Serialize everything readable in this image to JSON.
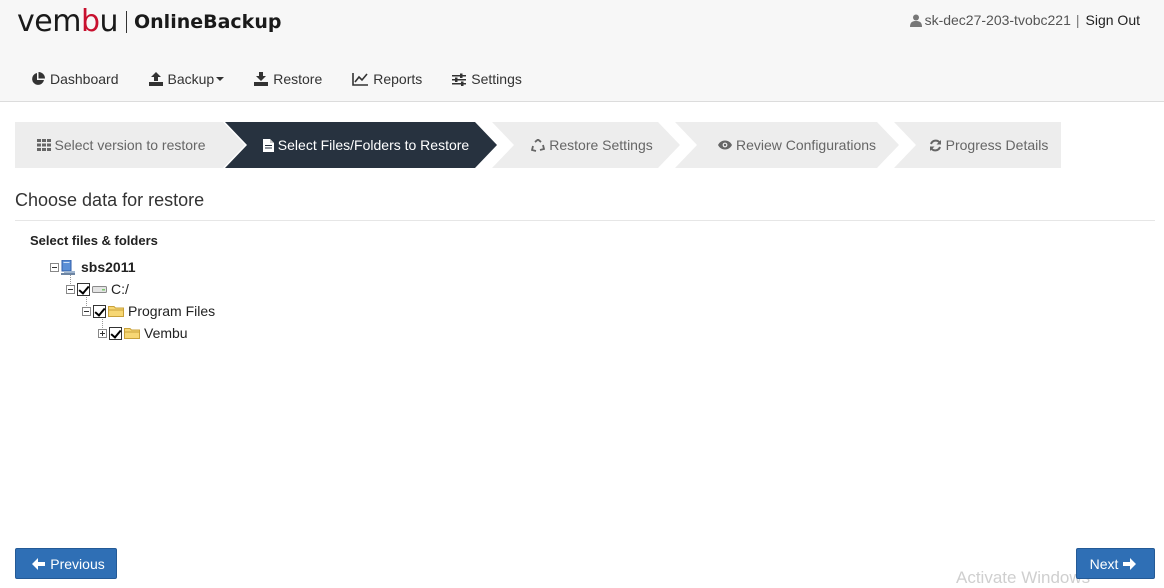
{
  "brand": {
    "word_start": "vem",
    "word_accent": "b",
    "word_end": "u",
    "product": "OnlineBackup"
  },
  "user": {
    "name": "sk-dec27-203-tvobc221",
    "separator": "|",
    "sign_out": "Sign Out"
  },
  "nav": {
    "dashboard": "Dashboard",
    "backup": "Backup",
    "restore": "Restore",
    "reports": "Reports",
    "settings": "Settings"
  },
  "wizard": {
    "steps": [
      {
        "label": "Select version to restore",
        "icon": "grid-icon"
      },
      {
        "label": "Select Files/Folders to Restore",
        "icon": "file-icon",
        "active": true
      },
      {
        "label": "Restore Settings",
        "icon": "recycle-icon"
      },
      {
        "label": "Review Configurations",
        "icon": "eye-icon"
      },
      {
        "label": "Progress Details",
        "icon": "refresh-icon"
      }
    ]
  },
  "content": {
    "title": "Choose data for restore",
    "tree_title": "Select files & folders",
    "tree": {
      "root": "sbs2011",
      "drive": "C:/",
      "folder": "Program Files",
      "subfolder": "Vembu"
    }
  },
  "buttons": {
    "previous": "Previous",
    "next": "Next"
  },
  "watermark": "Activate Windows",
  "colors": {
    "accent": "#c8102e",
    "active_step": "#27323f",
    "button": "#2f6fb5"
  }
}
